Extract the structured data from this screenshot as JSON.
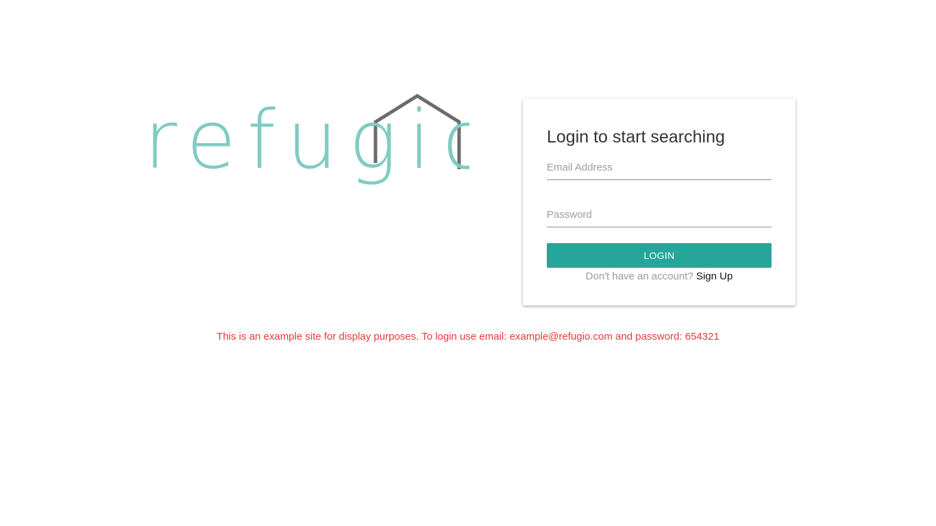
{
  "logo": {
    "text": "refugio",
    "text_color": "#80cbc4",
    "roof_color": "#6b6b6b",
    "icon": "house-roof-icon"
  },
  "login_card": {
    "title": "Login to start searching",
    "email_placeholder": "Email Address",
    "email_value": "",
    "password_placeholder": "Password",
    "password_value": "",
    "login_label": "LOGIN",
    "signup_prompt": "Don't have an account?",
    "signup_link": "Sign Up",
    "button_color": "#26a69a"
  },
  "notice": "This is an example site for display purposes. To login use email: example@refugio.com and password: 654321"
}
